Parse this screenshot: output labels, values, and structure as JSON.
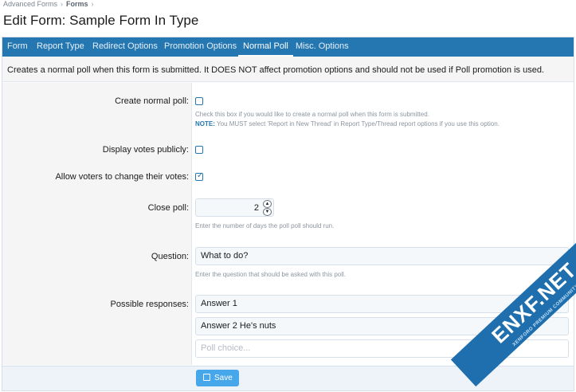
{
  "breadcrumb": [
    "Advanced Forms",
    "Forms"
  ],
  "page_title": "Edit Form: Sample Form In Type",
  "tabs": [
    {
      "label": "Form",
      "active": false
    },
    {
      "label": "Report Type",
      "active": false
    },
    {
      "label": "Redirect Options",
      "active": false
    },
    {
      "label": "Promotion Options",
      "active": false
    },
    {
      "label": "Normal Poll",
      "active": true
    },
    {
      "label": "Misc. Options",
      "active": false
    }
  ],
  "intro_text": "Creates a normal poll when this form is submitted. It DOES NOT affect promotion options and should not be used if Poll promotion is used.",
  "fields": {
    "create_normal_poll": {
      "label": "Create normal poll:",
      "checked": false,
      "hint": "Check this box if you would like to create a normal poll when this form is submitted.",
      "note_label": "NOTE:",
      "note_text": "You MUST select 'Report in New Thread' in Report Type/Thread report options if you use this option."
    },
    "display_votes_publicly": {
      "label": "Display votes publicly:",
      "checked": false
    },
    "allow_voters_change": {
      "label": "Allow voters to change their votes:",
      "checked": true
    },
    "close_poll": {
      "label": "Close poll:",
      "value": "2",
      "hint": "Enter the number of days the poll poll should run."
    },
    "question": {
      "label": "Question:",
      "value": "What to do?",
      "hint": "Enter the question that should be asked with this poll."
    },
    "possible_responses": {
      "label": "Possible responses:",
      "responses": [
        "Answer 1",
        "Answer 2 He's nuts"
      ],
      "placeholder": "Poll choice..."
    }
  },
  "footer": {
    "save_label": "Save"
  },
  "watermark": {
    "main": "ENXF.NET",
    "sub": "XENFORO PREMIUM COMMUNITY"
  },
  "colors": {
    "tab_bar": "#2577b1",
    "accent": "#47a7eb",
    "watermark": "#1f6fae"
  }
}
